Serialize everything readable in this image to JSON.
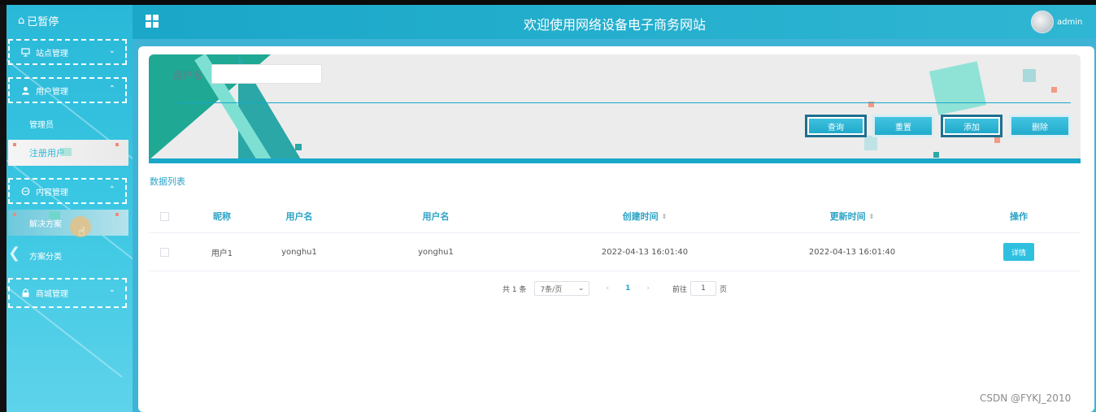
{
  "sidebar": {
    "title": "已暂停",
    "menus": [
      {
        "label": "站点管理",
        "expanded": false
      },
      {
        "label": "用户管理",
        "expanded": true,
        "children": [
          "管理员",
          "注册用户"
        ]
      },
      {
        "label": "内容管理",
        "expanded": true,
        "children": [
          "解决方案",
          "方案分类"
        ]
      },
      {
        "label": "商城管理",
        "expanded": false
      }
    ]
  },
  "header": {
    "title": "欢迎使用网络设备电子商务网站",
    "username": "admin"
  },
  "search": {
    "label": "用户名",
    "value": "",
    "buttons": {
      "query": "查询",
      "reset": "重置",
      "add": "添加",
      "delete": "删除"
    }
  },
  "list": {
    "title": "数据列表",
    "columns": [
      "昵称",
      "用户名",
      "用户名",
      "创建时间",
      "更新时间",
      "操作"
    ],
    "rows": [
      {
        "nickname": "用户1",
        "username": "yonghu1",
        "username2": "yonghu1",
        "created": "2022-04-13 16:01:40",
        "updated": "2022-04-13 16:01:40",
        "action": "详情"
      }
    ]
  },
  "pagination": {
    "total": "共 1 条",
    "page_size": "7条/页",
    "current_page": "1",
    "goto_label": "前往",
    "goto_value": "1",
    "page_unit": "页"
  },
  "watermark": "CSDN @FYKJ_2010",
  "colors": {
    "accent": "#2aa3c6",
    "header": "#1aa7c8",
    "sidebar": "#38c6e2"
  }
}
